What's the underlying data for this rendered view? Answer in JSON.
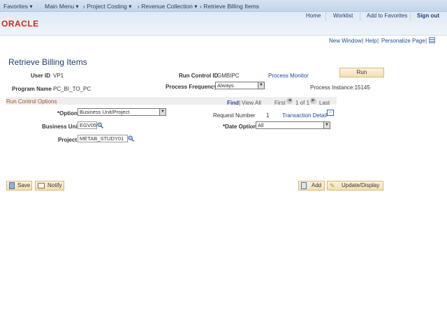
{
  "nav": {
    "favorites": "Favorites",
    "main_menu": "Main Menu",
    "crumbs": [
      "Project Costing",
      "Revenue Collection",
      "Retrieve Billing Items"
    ]
  },
  "header": {
    "logo": "ORACLE",
    "links": [
      "Home",
      "Worklist",
      "Add to Favorites",
      "Sign out"
    ]
  },
  "pagebar": {
    "new_window": "New Window",
    "help": "Help",
    "personalize": "Personalize Page"
  },
  "page_title": "Retrieve Billing Items",
  "fields": {
    "user_id_label": "User ID",
    "user_id": "VP1",
    "run_control_label": "Run Control ID",
    "run_control": "GMBIPC",
    "process_monitor": "Process Monitor",
    "run": "Run",
    "program_name_label": "Program Name",
    "program_name": "PC_BI_TO_PC",
    "process_frequency_label": "Process Frequency",
    "process_frequency": "Always",
    "process_instance": "Process Instance:15145"
  },
  "section": {
    "title": "Run Control Options",
    "find": "Find",
    "view_all": "View All",
    "first": "First",
    "counter": "1 of 1",
    "last": "Last"
  },
  "options": {
    "option_label": "*Option",
    "option": "Business Unit/Project",
    "request_number_label": "Request Number",
    "request_number": "1",
    "transaction_detail": "Transaction Detail",
    "business_unit_label": "Business Unit",
    "business_unit": "EGV05",
    "date_option_label": "*Date Option",
    "date_option": "All",
    "project_label": "Project",
    "project": "METAB_STUDY01"
  },
  "buttons": {
    "save": "Save",
    "notify": "Notify",
    "add": "Add",
    "update": "Update/Display"
  }
}
